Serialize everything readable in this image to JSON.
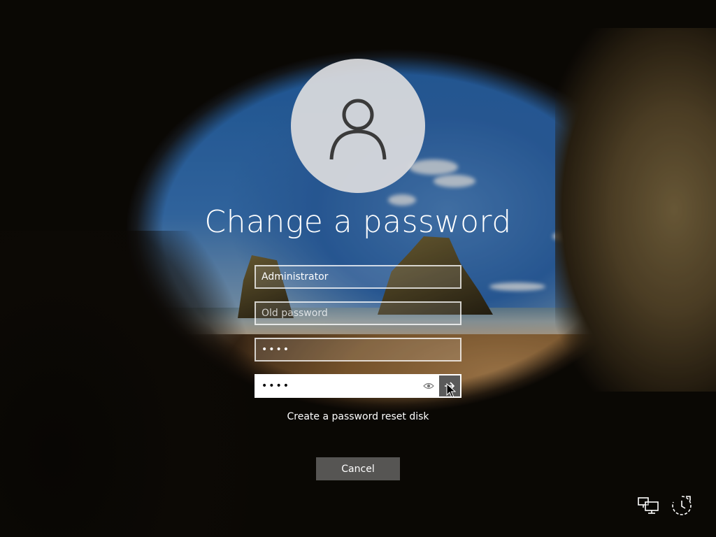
{
  "screen": {
    "title": "Change a password",
    "username": "Administrator",
    "old_password_placeholder": "Old password",
    "new_password_value": "••••",
    "confirm_password_value": "••••",
    "reset_disk_link": "Create a password reset disk",
    "cancel_label": "Cancel"
  },
  "icons": {
    "avatar": "user-icon",
    "reveal": "eye-icon",
    "submit": "arrow-right-icon",
    "network": "network-icon",
    "ease_of_access": "ease-of-access-icon"
  },
  "colors": {
    "accent": "#ffffff",
    "submit_button": "#5a5a5a",
    "cancel_button": "#969696"
  }
}
